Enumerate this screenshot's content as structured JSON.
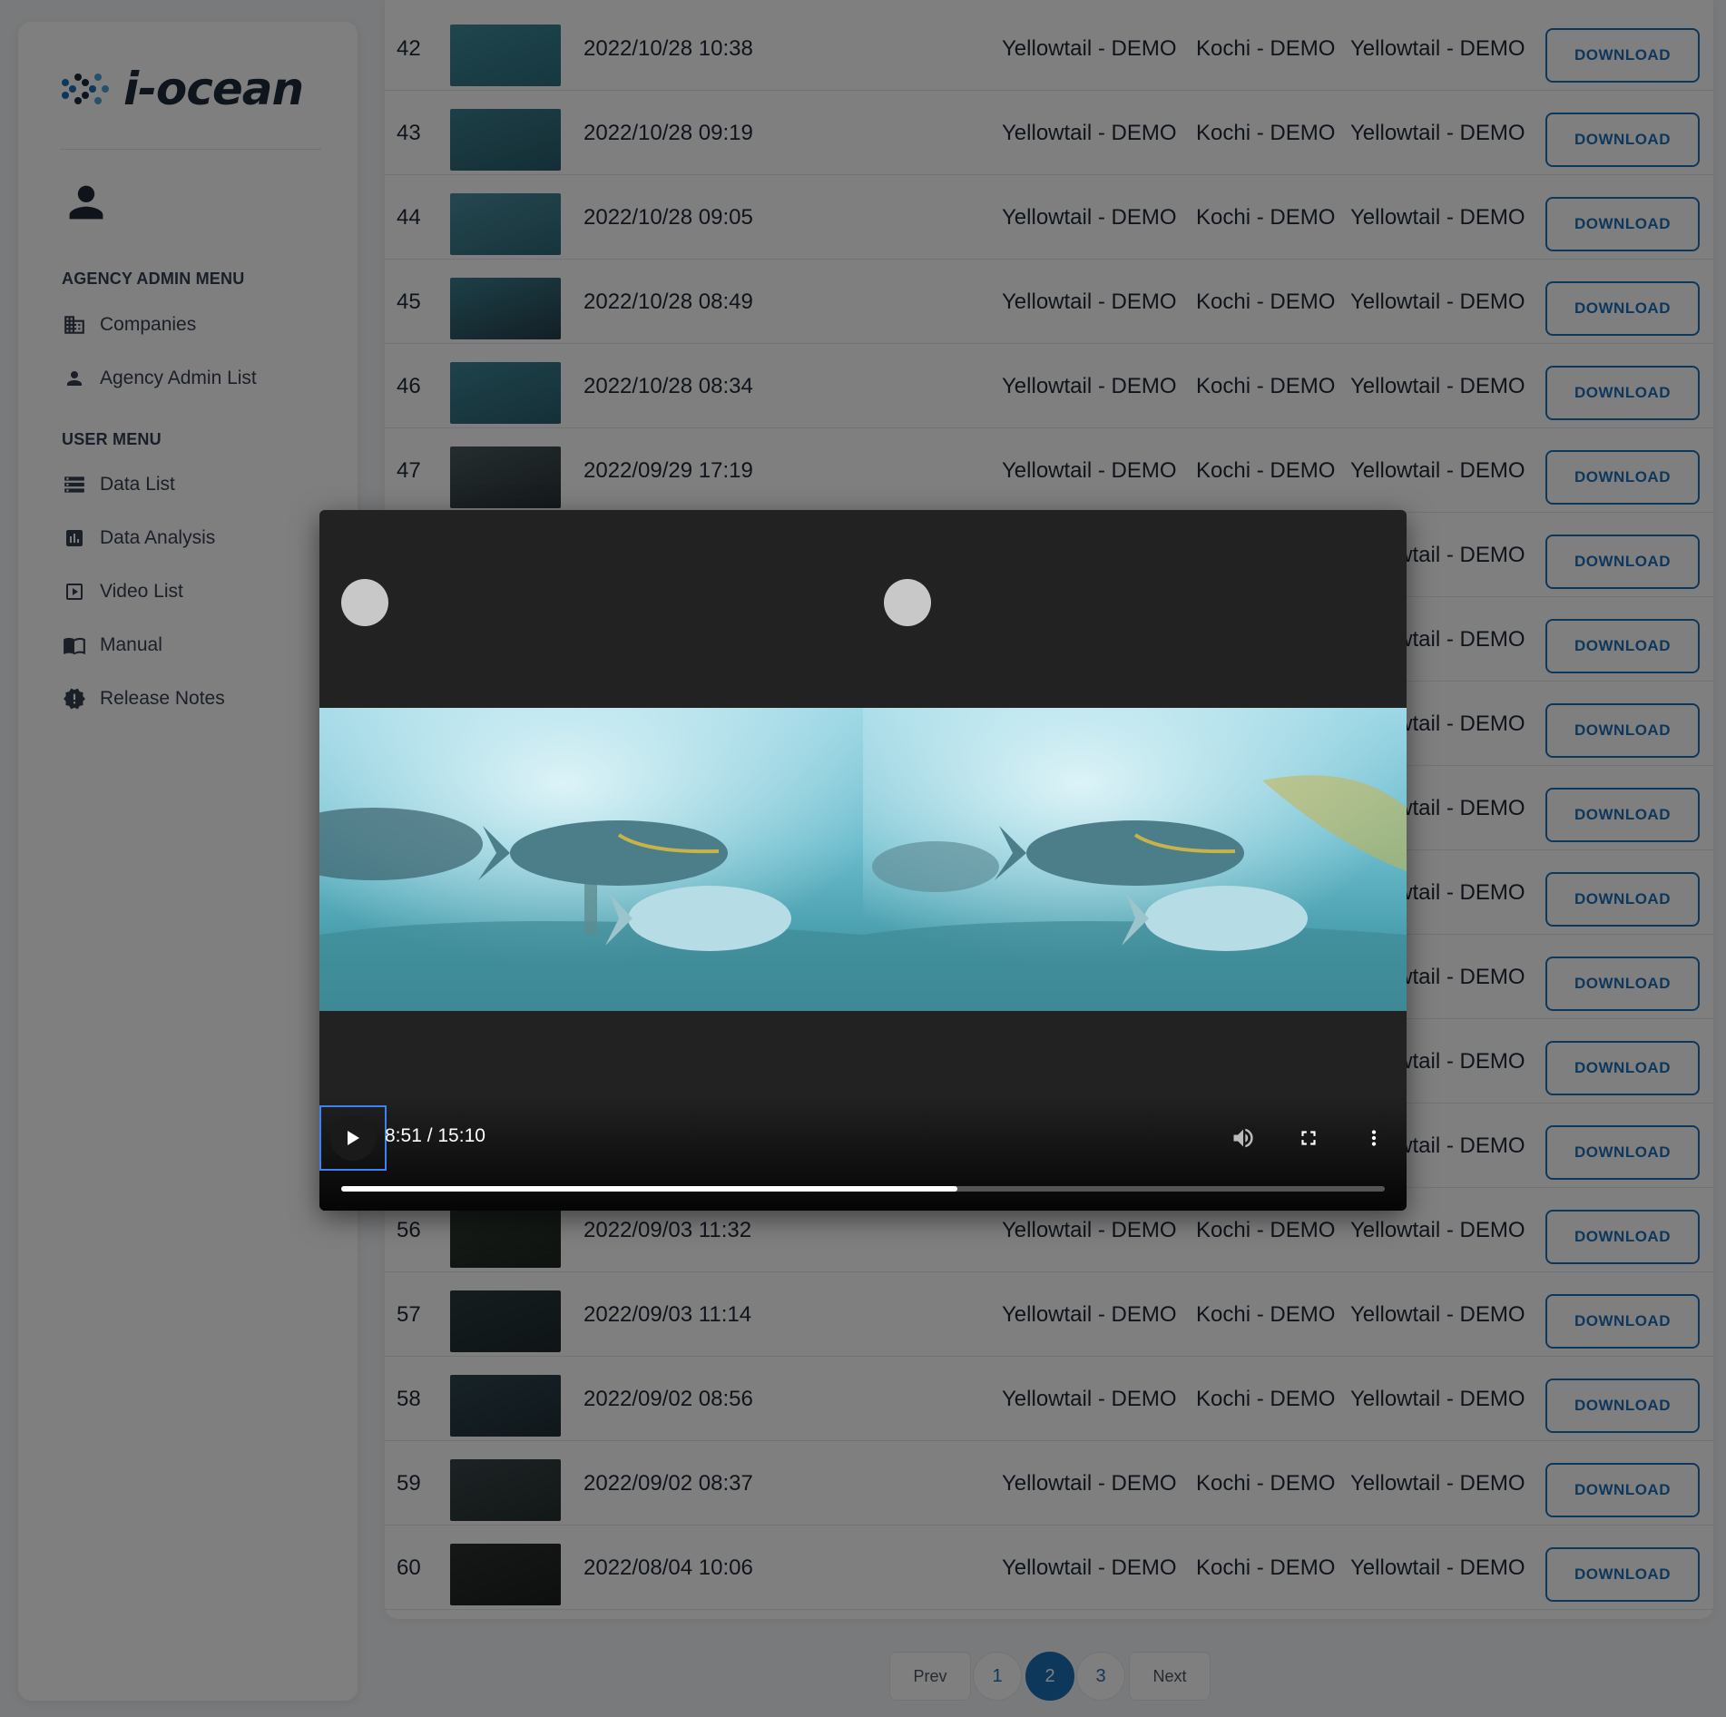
{
  "sidebar": {
    "logo_text": "i-ocean",
    "agency_heading": "AGENCY ADMIN MENU",
    "agency_items": [
      {
        "label": "Companies",
        "icon": "building-icon"
      },
      {
        "label": "Agency Admin List",
        "icon": "person-icon"
      }
    ],
    "user_heading": "USER MENU",
    "user_items": [
      {
        "label": "Data List",
        "icon": "storage-list-icon"
      },
      {
        "label": "Data Analysis",
        "icon": "bar-chart-icon"
      },
      {
        "label": "Video List",
        "icon": "play-box-icon"
      },
      {
        "label": "Manual",
        "icon": "book-icon"
      },
      {
        "label": "Release Notes",
        "icon": "alert-badge-icon"
      }
    ]
  },
  "table": {
    "download_label": "DOWNLOAD",
    "rows": [
      {
        "num": "42",
        "date": "2022/10/28 10:38",
        "a": "Yellowtail - DEMO",
        "b": "Kochi - DEMO",
        "c": "Yellowtail - DEMO"
      },
      {
        "num": "43",
        "date": "2022/10/28 09:19",
        "a": "Yellowtail - DEMO",
        "b": "Kochi - DEMO",
        "c": "Yellowtail - DEMO"
      },
      {
        "num": "44",
        "date": "2022/10/28 09:05",
        "a": "Yellowtail - DEMO",
        "b": "Kochi - DEMO",
        "c": "Yellowtail - DEMO"
      },
      {
        "num": "45",
        "date": "2022/10/28 08:49",
        "a": "Yellowtail - DEMO",
        "b": "Kochi - DEMO",
        "c": "Yellowtail - DEMO"
      },
      {
        "num": "46",
        "date": "2022/10/28 08:34",
        "a": "Yellowtail - DEMO",
        "b": "Kochi - DEMO",
        "c": "Yellowtail - DEMO"
      },
      {
        "num": "47",
        "date": "2022/09/29 17:19",
        "a": "Yellowtail - DEMO",
        "b": "Kochi - DEMO",
        "c": "Yellowtail - DEMO"
      },
      {
        "num": "",
        "date": "",
        "a": "",
        "b": "",
        "c": "Yellowtail - DEMO"
      },
      {
        "num": "",
        "date": "",
        "a": "",
        "b": "",
        "c": "Yellowtail - DEMO"
      },
      {
        "num": "",
        "date": "",
        "a": "",
        "b": "",
        "c": "Yellowtail - DEMO"
      },
      {
        "num": "",
        "date": "",
        "a": "",
        "b": "",
        "c": "Yellowtail - DEMO"
      },
      {
        "num": "",
        "date": "",
        "a": "",
        "b": "",
        "c": "Yellowtail - DEMO"
      },
      {
        "num": "",
        "date": "",
        "a": "",
        "b": "",
        "c": "Yellowtail - DEMO"
      },
      {
        "num": "",
        "date": "",
        "a": "",
        "b": "",
        "c": "Yellowtail - DEMO"
      },
      {
        "num": "",
        "date": "",
        "a": "",
        "b": "",
        "c": "Yellowtail - DEMO"
      },
      {
        "num": "56",
        "date": "2022/09/03 11:32",
        "a": "Yellowtail - DEMO",
        "b": "Kochi - DEMO",
        "c": "Yellowtail - DEMO"
      },
      {
        "num": "57",
        "date": "2022/09/03 11:14",
        "a": "Yellowtail - DEMO",
        "b": "Kochi - DEMO",
        "c": "Yellowtail - DEMO"
      },
      {
        "num": "58",
        "date": "2022/09/02 08:56",
        "a": "Yellowtail - DEMO",
        "b": "Kochi - DEMO",
        "c": "Yellowtail - DEMO"
      },
      {
        "num": "59",
        "date": "2022/09/02 08:37",
        "a": "Yellowtail - DEMO",
        "b": "Kochi - DEMO",
        "c": "Yellowtail - DEMO"
      },
      {
        "num": "60",
        "date": "2022/08/04 10:06",
        "a": "Yellowtail - DEMO",
        "b": "Kochi - DEMO",
        "c": "Yellowtail - DEMO"
      }
    ]
  },
  "pagination": {
    "prev": "Prev",
    "pages": [
      "1",
      "2",
      "3"
    ],
    "active_page": "2",
    "next": "Next"
  },
  "video": {
    "time_display": "8:51 / 15:10",
    "progress_fraction": 0.59,
    "play_icon": "play-icon",
    "volume_icon": "volume-icon",
    "fullscreen_icon": "fullscreen-icon",
    "more_icon": "more-vert-icon"
  },
  "colors": {
    "accent": "#1d6fb8",
    "logo_dark": "#1e2a3a",
    "logo_blue": "#1d6fb8"
  }
}
